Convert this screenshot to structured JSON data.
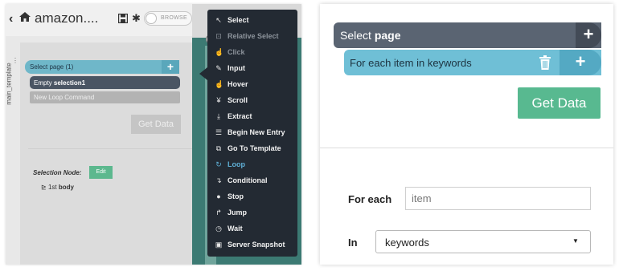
{
  "left": {
    "header": {
      "title": "amazon....",
      "browse_label": "BROWSE"
    },
    "side_tab": "main_template",
    "command_tree": {
      "select_row": "Select page  (1)",
      "empty_selection_prefix": "Empty ",
      "empty_selection_bold": "selection1",
      "new_loop": "New Loop Command",
      "get_data": "Get Data"
    },
    "selection_node": {
      "label": "Selection Node:",
      "edit": "Edit",
      "body_prefix": "1st",
      "body_bold": "body"
    },
    "menu": [
      {
        "label": "Select",
        "icon": "cursor-icon",
        "glyph": "↖",
        "state": "normal"
      },
      {
        "label": "Relative Select",
        "icon": "relative-select-icon",
        "glyph": "⊡",
        "state": "disabled"
      },
      {
        "label": "Click",
        "icon": "hand-pointer-icon",
        "glyph": "☝",
        "state": "disabled"
      },
      {
        "label": "Input",
        "icon": "pencil-icon",
        "glyph": "✎",
        "state": "normal"
      },
      {
        "label": "Hover",
        "icon": "hover-hand-icon",
        "glyph": "☝",
        "state": "normal"
      },
      {
        "label": "Scroll",
        "icon": "scroll-icon",
        "glyph": "¥",
        "state": "normal"
      },
      {
        "label": "Extract",
        "icon": "download-icon",
        "glyph": "⤓",
        "state": "normal"
      },
      {
        "label": "Begin New Entry",
        "icon": "list-icon",
        "glyph": "☰",
        "state": "normal"
      },
      {
        "label": "Go To Template",
        "icon": "external-link-icon",
        "glyph": "⧉",
        "state": "normal"
      },
      {
        "label": "Loop",
        "icon": "loop-icon",
        "glyph": "↻",
        "state": "active"
      },
      {
        "label": "Conditional",
        "icon": "conditional-icon",
        "glyph": "↴",
        "state": "normal"
      },
      {
        "label": "Stop",
        "icon": "stop-icon",
        "glyph": "●",
        "state": "normal"
      },
      {
        "label": "Jump",
        "icon": "jump-arrow-icon",
        "glyph": "↱",
        "state": "normal"
      },
      {
        "label": "Wait",
        "icon": "clock-icon",
        "glyph": "◷",
        "state": "normal"
      },
      {
        "label": "Server Snapshot",
        "icon": "camera-icon",
        "glyph": "▣",
        "state": "normal"
      }
    ]
  },
  "right": {
    "select_row": {
      "prefix": "Select ",
      "bold": "page"
    },
    "loop_row": "For each item in keywords",
    "get_data": "Get Data",
    "for_each_label": "For each",
    "for_each_value": "item",
    "in_label": "In",
    "in_value": "keywords"
  },
  "colors": {
    "menu_bg": "#232a33",
    "active_accent": "#5fb0d6",
    "green": "#58b990",
    "select_blue": "#6fbfd6",
    "dark_row": "#5a6472"
  }
}
